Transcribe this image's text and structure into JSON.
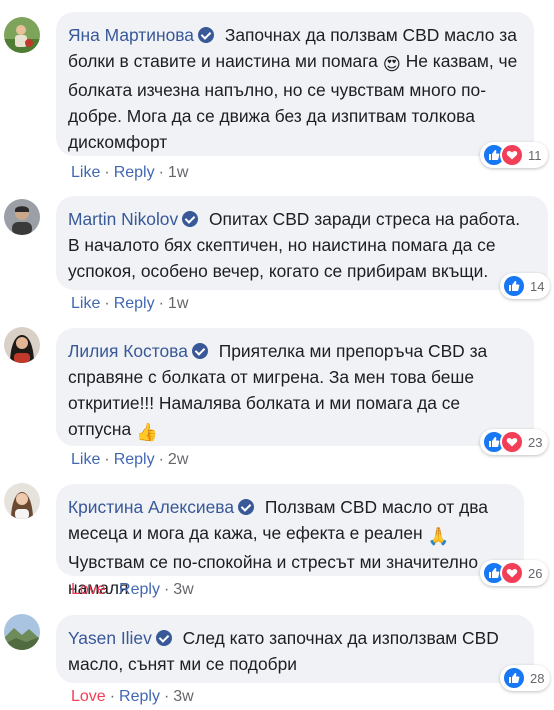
{
  "comments": [
    {
      "name": "Яна Мартинова",
      "avatar": "avatar-person-outdoors",
      "text_a": "Започнах да ползвам CBD масло за болки в ставите и наистина ми помага",
      "emoji_a": "😍",
      "text_b": "Не казвам, че болката изчезна напълно, но се чувствам много по-добре. Мога да се движа без да изпитвам толкова дискомфорт",
      "reactions": [
        "like",
        "love"
      ],
      "reaction_count": "11",
      "action": "Like",
      "reply": "Reply",
      "time": "1w"
    },
    {
      "name": "Martin Nikolov",
      "avatar": "avatar-person-dark",
      "text_a": "Опитах CBD заради стреса на работа. В началото бях скептичен, но наистина помага да се успокоя, особено вечер, когато се прибирам вкъщи.",
      "reactions": [
        "like"
      ],
      "reaction_count": "14",
      "action": "Like",
      "reply": "Reply",
      "time": "1w"
    },
    {
      "name": "Лилия Костова",
      "avatar": "avatar-person-red",
      "text_a": "Приятелка ми препоръча CBD за справяне с болката от мигрена. За мен това беше откритие!!! Намалява болката и ми помага да се отпусна",
      "emoji_a": "👍",
      "reactions": [
        "like",
        "love"
      ],
      "reaction_count": "23",
      "action": "Like",
      "reply": "Reply",
      "time": "2w"
    },
    {
      "name": "Кристина Алексиева",
      "avatar": "avatar-person-light",
      "text_a": "Ползвам CBD масло от два месеца и мога да кажа, че ефекта е реален",
      "emoji_a": "🙏",
      "text_b": "Чувствам се по-спокойна и стресът ми значително намаля",
      "reactions": [
        "like",
        "love"
      ],
      "reaction_count": "26",
      "action": "Love",
      "reply": "Reply",
      "time": "3w"
    },
    {
      "name": "Yasen Iliev",
      "avatar": "avatar-landscape",
      "text_a": "След като започнах да използвам CBD масло, сънят ми се подобри",
      "reactions": [
        "like"
      ],
      "reaction_count": "28",
      "action": "Love",
      "reply": "Reply",
      "time": "3w"
    }
  ],
  "colors": {
    "name": "#385898",
    "bubble": "#f0f2f5",
    "like": "#1877f2",
    "love": "#f33e58",
    "meta": "#65676b"
  }
}
